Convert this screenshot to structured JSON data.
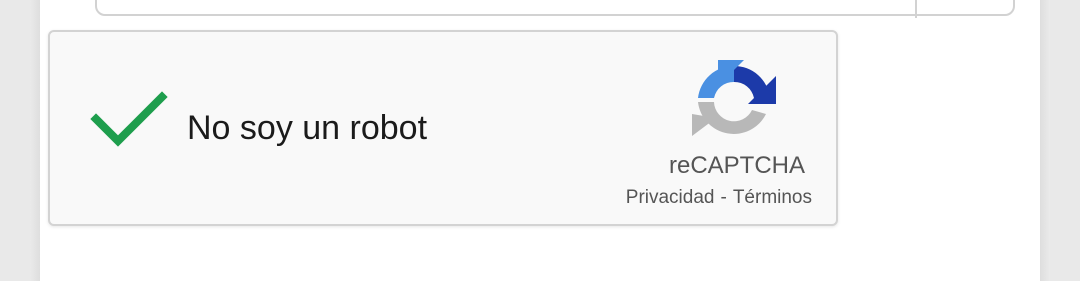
{
  "recaptcha": {
    "checkbox_label": "No soy un robot",
    "checked": true,
    "brand": "reCAPTCHA",
    "privacy_link": "Privacidad",
    "separator": "-",
    "terms_link": "Términos",
    "check_color": "#1e9e4d",
    "logo_colors": {
      "dark_blue": "#1c3aa9",
      "light_blue": "#4a90e2",
      "gray": "#b8b8b8"
    }
  },
  "icons": {
    "check": "checkmark-icon",
    "logo": "recaptcha-logo-icon"
  }
}
